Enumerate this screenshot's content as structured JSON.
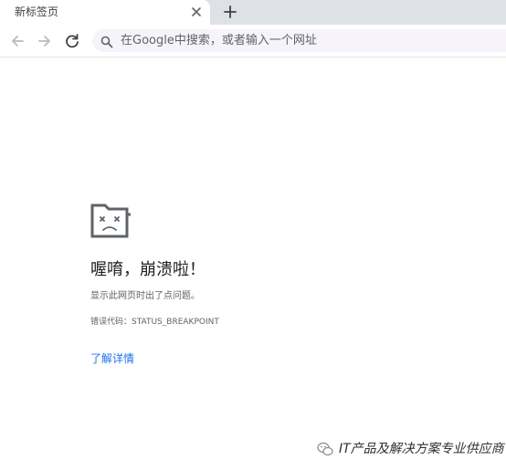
{
  "tabs": [
    {
      "title": "新标签页",
      "active": true
    }
  ],
  "icons": {
    "tab_close": "close-icon",
    "new_tab": "plus-icon",
    "back": "back-arrow-icon",
    "forward": "forward-arrow-icon",
    "reload": "reload-icon",
    "omnibox_search": "search-icon",
    "crash": "sad-folder-icon",
    "watermark": "wechat-icon"
  },
  "omnibox": {
    "placeholder": "在Google中搜索，或者输入一个网址"
  },
  "crash_page": {
    "title": "喔唷，崩溃啦！",
    "description": "显示此网页时出了点问题。",
    "error_code": "错误代码：STATUS_BREAKPOINT",
    "details_link": "了解详情"
  },
  "watermark": {
    "text": "IT产品及解决方案专业供应商"
  },
  "colors": {
    "tabstrip_bg": "#dee1e6",
    "omnibox_bg": "#f6f3fb",
    "link": "#1a73e8",
    "icon": "#5f6368",
    "disabled_icon": "#b8bbbf"
  }
}
